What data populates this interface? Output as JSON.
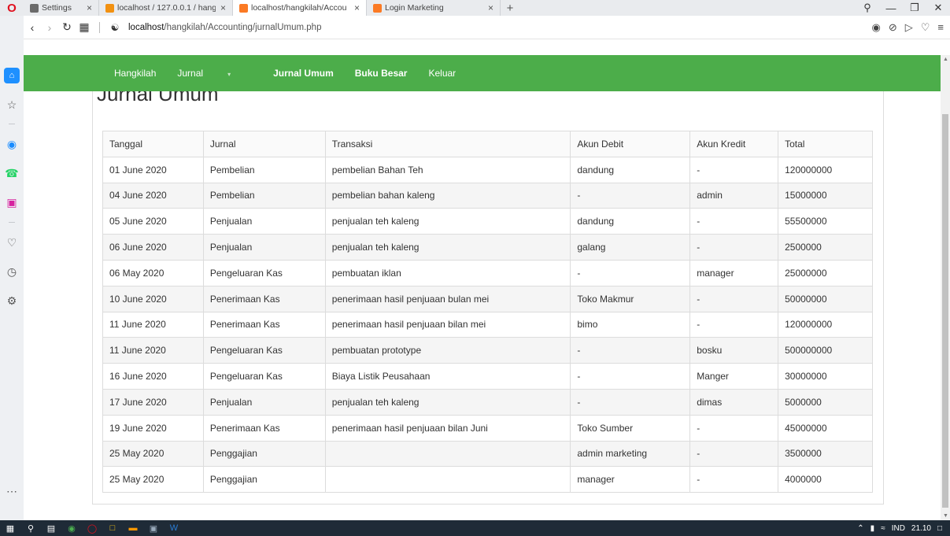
{
  "browser": {
    "tabs": [
      {
        "title": "Settings",
        "favicon": "gear-icon",
        "color": "#6b6b6b",
        "width": 96
      },
      {
        "title": "localhost / 127.0.0.1 / hang",
        "favicon": "phpmyadmin-icon",
        "color": "#f29111",
        "width": 170
      },
      {
        "title": "localhost/hangkilah/Accou",
        "favicon": "xampp-icon",
        "color": "#fb7a24",
        "width": 170
      },
      {
        "title": "Login Marketing",
        "favicon": "xampp-icon",
        "color": "#fb7a24",
        "width": 170
      }
    ],
    "url_host": "localhost",
    "url_path": "/hangkilah/Accounting/jurnalUmum.php"
  },
  "navbar": {
    "brand": "Hangkilah",
    "items": [
      "Jurnal",
      "Jurnal Umum",
      "Buku Besar",
      "Keluar"
    ]
  },
  "page": {
    "title": "Jurnal Umum"
  },
  "table": {
    "headers": [
      "Tanggal",
      "Jurnal",
      "Transaksi",
      "Akun Debit",
      "Akun Kredit",
      "Total"
    ],
    "rows": [
      [
        "01 June 2020",
        "Pembelian",
        "pembelian Bahan Teh",
        "dandung",
        "-",
        "120000000"
      ],
      [
        "04 June 2020",
        "Pembelian",
        "pembelian bahan kaleng",
        "-",
        "admin",
        "15000000"
      ],
      [
        "05 June 2020",
        "Penjualan",
        "penjualan teh kaleng",
        "dandung",
        "-",
        "55500000"
      ],
      [
        "06 June 2020",
        "Penjualan",
        "penjualan teh kaleng",
        "galang",
        "-",
        "2500000"
      ],
      [
        "06 May 2020",
        "Pengeluaran Kas",
        "pembuatan iklan",
        "-",
        "manager",
        "25000000"
      ],
      [
        "10 June 2020",
        "Penerimaan Kas",
        "penerimaan hasil penjuaan bulan mei",
        "Toko Makmur",
        "-",
        "50000000"
      ],
      [
        "11 June 2020",
        "Penerimaan Kas",
        "penerimaan hasil penjuaan bilan mei",
        "bimo",
        "-",
        "120000000"
      ],
      [
        "11 June 2020",
        "Pengeluaran Kas",
        "pembuatan prototype",
        "-",
        "bosku",
        "500000000"
      ],
      [
        "16 June 2020",
        "Pengeluaran Kas",
        "Biaya Listik Peusahaan",
        "-",
        "Manger",
        "30000000"
      ],
      [
        "17 June 2020",
        "Penjualan",
        "penjualan teh kaleng",
        "-",
        "dimas",
        "5000000"
      ],
      [
        "19 June 2020",
        "Penerimaan Kas",
        "penerimaan hasil penjuaan bilan Juni",
        "Toko Sumber",
        "-",
        "45000000"
      ],
      [
        "25 May 2020",
        "Penggajian",
        "",
        "admin marketing",
        "-",
        "3500000"
      ],
      [
        "25 May 2020",
        "Penggajian",
        "",
        "manager",
        "-",
        "4000000"
      ]
    ]
  },
  "taskbar": {
    "tray_lang": "IND",
    "tray_time": "21.10"
  },
  "colors": {
    "navbar": "#4cad4a",
    "opera": "#e0101e"
  }
}
